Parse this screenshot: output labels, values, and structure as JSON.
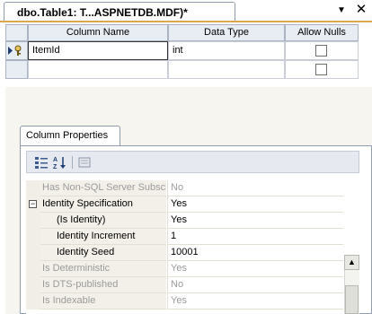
{
  "document_tab": {
    "title": "dbo.Table1: T...ASPNETDB.MDF)*",
    "dropdown_icon": "dropdown-arrow-icon",
    "close_label": "✕"
  },
  "grid": {
    "headers": [
      "Column Name",
      "Data Type",
      "Allow Nulls"
    ],
    "rows": [
      {
        "column_name": "ItemId",
        "data_type": "int",
        "allow_nulls": false,
        "primary_key": true,
        "current": true
      },
      {
        "column_name": "",
        "data_type": "",
        "allow_nulls": false,
        "primary_key": false,
        "current": false
      }
    ]
  },
  "column_properties": {
    "tab_label": "Column Properties",
    "toolbar": [
      "categorized-icon",
      "alphabetical-icon",
      "property-pages-icon"
    ],
    "properties": [
      {
        "name": "Has Non-SQL Server Subscriber",
        "value": "No",
        "enabled": false,
        "indent": 0,
        "expander": ""
      },
      {
        "name": "Identity Specification",
        "value": "Yes",
        "enabled": true,
        "indent": 0,
        "expander": "minus"
      },
      {
        "name": "(Is Identity)",
        "value": "Yes",
        "enabled": true,
        "indent": 1,
        "expander": ""
      },
      {
        "name": "Identity Increment",
        "value": "1",
        "enabled": true,
        "indent": 1,
        "expander": ""
      },
      {
        "name": "Identity Seed",
        "value": "10001",
        "enabled": true,
        "indent": 1,
        "expander": ""
      },
      {
        "name": "Is Deterministic",
        "value": "Yes",
        "enabled": false,
        "indent": 0,
        "expander": ""
      },
      {
        "name": "Is DTS-published",
        "value": "No",
        "enabled": false,
        "indent": 0,
        "expander": ""
      },
      {
        "name": "Is Indexable",
        "value": "Yes",
        "enabled": false,
        "indent": 0,
        "expander": ""
      }
    ]
  },
  "colors": {
    "accent_tab_underline": "#d9a84f",
    "disabled_text": "#9b9b9b"
  }
}
